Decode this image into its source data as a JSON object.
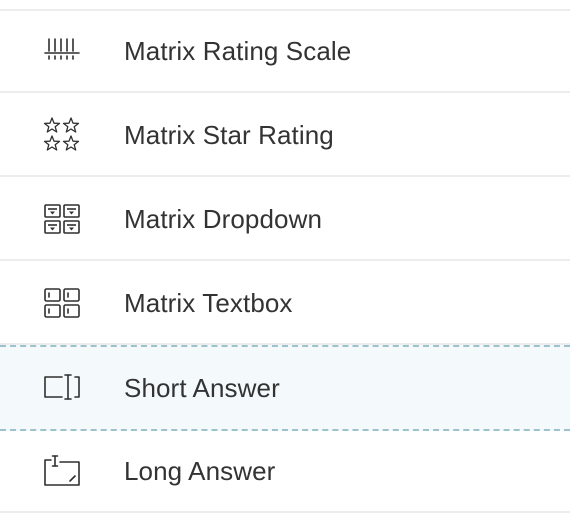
{
  "question_types": {
    "items": [
      {
        "label": "Matrix Rating Scale",
        "icon": "rating-scale-icon"
      },
      {
        "label": "Matrix Star Rating",
        "icon": "star-rating-icon"
      },
      {
        "label": "Matrix Dropdown",
        "icon": "matrix-dropdown-icon"
      },
      {
        "label": "Matrix Textbox",
        "icon": "matrix-textbox-icon"
      },
      {
        "label": "Short Answer",
        "icon": "short-answer-icon",
        "highlighted": true
      },
      {
        "label": "Long Answer",
        "icon": "long-answer-icon"
      }
    ]
  },
  "colors": {
    "text": "#333333",
    "divider": "#ececec",
    "highlight_bg": "#f4fafb",
    "highlight_border": "#9cc3cc",
    "icon_stroke": "#2f2f2f"
  }
}
